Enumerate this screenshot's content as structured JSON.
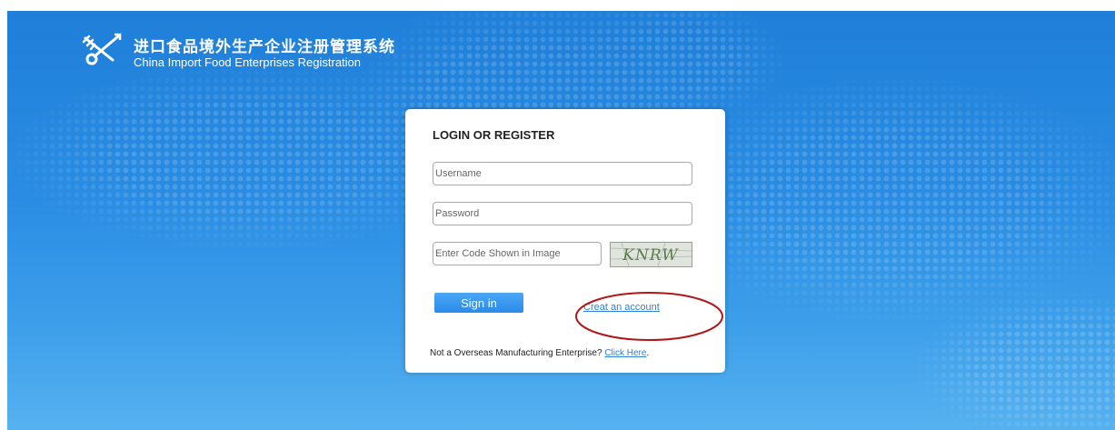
{
  "header": {
    "title_cn": "进口食品境外生产企业注册管理系统",
    "title_en": "China Import Food Enterprises Registration",
    "logo_icon": "crossed-tools-logo-icon"
  },
  "login": {
    "heading": "LOGIN OR REGISTER",
    "username": {
      "placeholder": "Username",
      "value": ""
    },
    "password": {
      "placeholder": "Password",
      "value": ""
    },
    "code": {
      "placeholder": "Enter Code Shown in Image",
      "value": ""
    },
    "captcha_text": "KNRW",
    "signin_label": "Sign in",
    "create_account_label": "Creat an account",
    "footer_text": "Not a Overseas Manufacturing Enterprise? ",
    "footer_link": "Click Here",
    "footer_end": "."
  },
  "colors": {
    "background_top": "#1f7fd9",
    "background_bottom": "#56b1ef",
    "button": "#2b8be8",
    "link": "#2a83d6",
    "annotation_ellipse": "#b01818"
  }
}
